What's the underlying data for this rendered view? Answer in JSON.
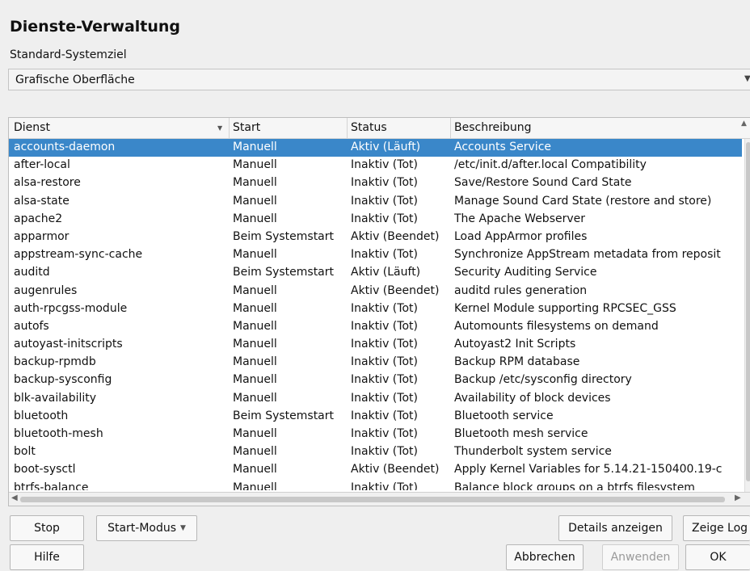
{
  "title": "Dienste-Verwaltung",
  "target_label": "Standard-Systemziel",
  "target_value": "Grafische Oberfläche",
  "table": {
    "headers": [
      "Dienst",
      "Start",
      "Status",
      "Beschreibung"
    ],
    "rows": [
      [
        "accounts-daemon",
        "Manuell",
        "Aktiv (Läuft)",
        "Accounts Service"
      ],
      [
        "after-local",
        "Manuell",
        "Inaktiv (Tot)",
        "/etc/init.d/after.local Compatibility"
      ],
      [
        "alsa-restore",
        "Manuell",
        "Inaktiv (Tot)",
        "Save/Restore Sound Card State"
      ],
      [
        "alsa-state",
        "Manuell",
        "Inaktiv (Tot)",
        "Manage Sound Card State (restore and store)"
      ],
      [
        "apache2",
        "Manuell",
        "Inaktiv (Tot)",
        "The Apache Webserver"
      ],
      [
        "apparmor",
        "Beim Systemstart",
        "Aktiv (Beendet)",
        "Load AppArmor profiles"
      ],
      [
        "appstream-sync-cache",
        "Manuell",
        "Inaktiv (Tot)",
        "Synchronize AppStream metadata from reposit"
      ],
      [
        "auditd",
        "Beim Systemstart",
        "Aktiv (Läuft)",
        "Security Auditing Service"
      ],
      [
        "augenrules",
        "Manuell",
        "Aktiv (Beendet)",
        "auditd rules generation"
      ],
      [
        "auth-rpcgss-module",
        "Manuell",
        "Inaktiv (Tot)",
        "Kernel Module supporting RPCSEC_GSS"
      ],
      [
        "autofs",
        "Manuell",
        "Inaktiv (Tot)",
        "Automounts filesystems on demand"
      ],
      [
        "autoyast-initscripts",
        "Manuell",
        "Inaktiv (Tot)",
        "Autoyast2 Init Scripts"
      ],
      [
        "backup-rpmdb",
        "Manuell",
        "Inaktiv (Tot)",
        "Backup RPM database"
      ],
      [
        "backup-sysconfig",
        "Manuell",
        "Inaktiv (Tot)",
        "Backup /etc/sysconfig directory"
      ],
      [
        "blk-availability",
        "Manuell",
        "Inaktiv (Tot)",
        "Availability of block devices"
      ],
      [
        "bluetooth",
        "Beim Systemstart",
        "Inaktiv (Tot)",
        "Bluetooth service"
      ],
      [
        "bluetooth-mesh",
        "Manuell",
        "Inaktiv (Tot)",
        "Bluetooth mesh service"
      ],
      [
        "bolt",
        "Manuell",
        "Inaktiv (Tot)",
        "Thunderbolt system service"
      ],
      [
        "boot-sysctl",
        "Manuell",
        "Aktiv (Beendet)",
        "Apply Kernel Variables for 5.14.21-150400.19-c"
      ],
      [
        "btrfs-balance",
        "Manuell",
        "Inaktiv (Tot)",
        "Balance block groups on a btrfs filesystem"
      ]
    ]
  },
  "buttons": {
    "stop": "Stop",
    "start_mode": "Start-Modus",
    "details": "Details anzeigen",
    "show_log": "Zeige Log",
    "help": "Hilfe",
    "cancel": "Abbrechen",
    "apply": "Anwenden",
    "ok": "OK"
  },
  "colors": {
    "selection": "#3a87c9"
  }
}
